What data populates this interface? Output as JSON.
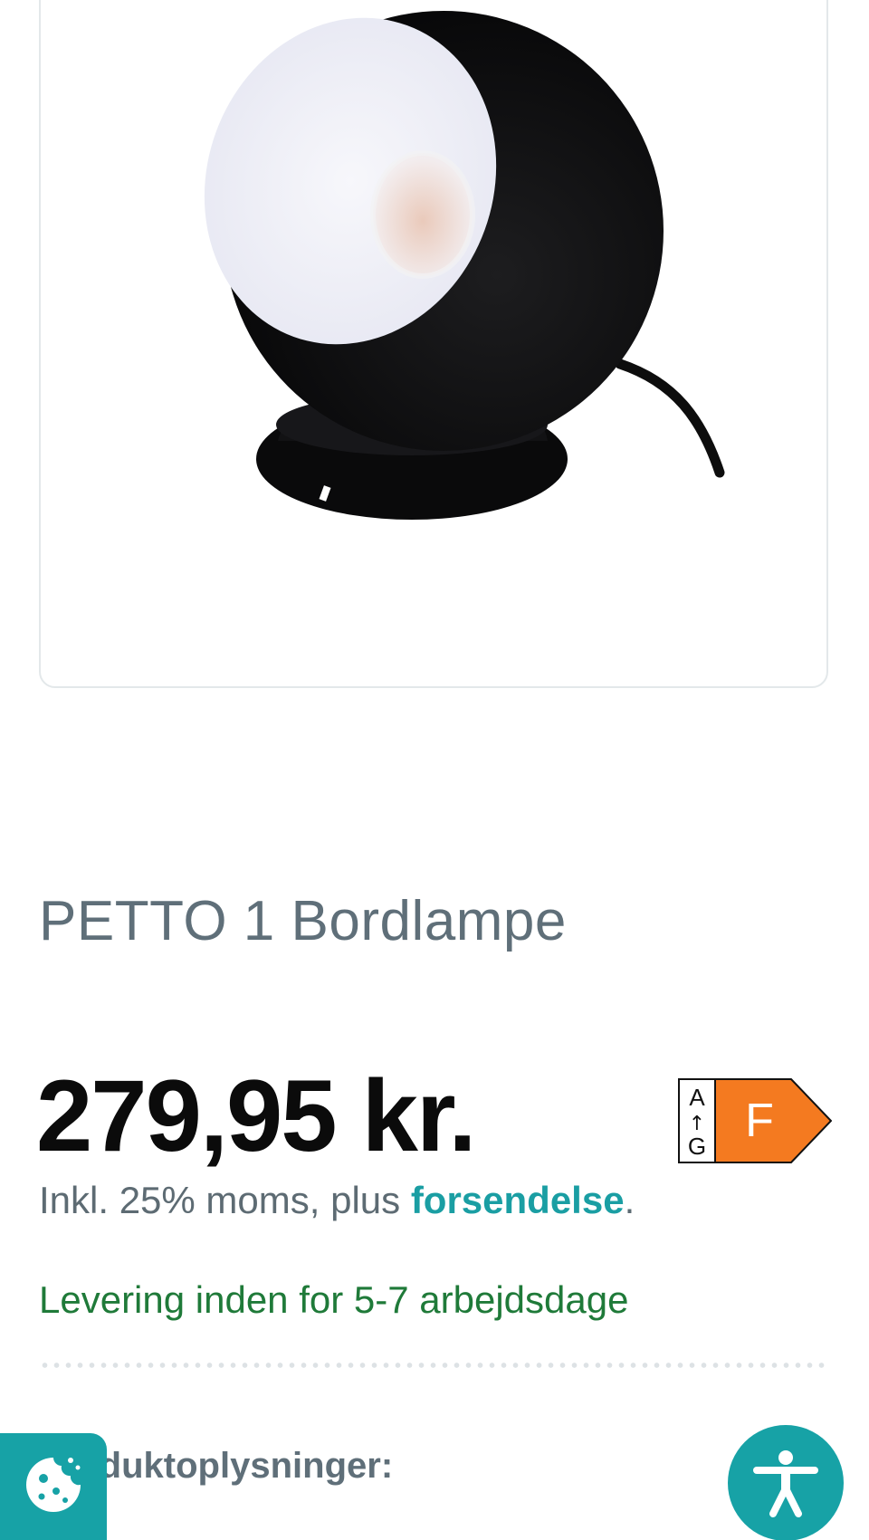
{
  "product": {
    "title": "PETTO 1 Bordlampe",
    "price": "279,95 kr.",
    "vat_text": "Inkl. 25% moms, plus ",
    "shipping_link": "forsendelse",
    "vat_suffix": ".",
    "delivery": "Levering inden for 5-7 arbejdsdage"
  },
  "energy_label": {
    "scale_top": "A",
    "scale_arrow": "↑",
    "scale_bottom": "G",
    "grade": "F",
    "color": "#f47a20"
  },
  "section": {
    "heading": "Produktoplysninger:"
  },
  "icons": {
    "cookie": "cookie-icon",
    "accessibility": "accessibility-icon"
  },
  "colors": {
    "accent": "#17a2a6",
    "title": "#5f6f79",
    "delivery": "#1f7a39",
    "price": "#0b0b0b"
  }
}
